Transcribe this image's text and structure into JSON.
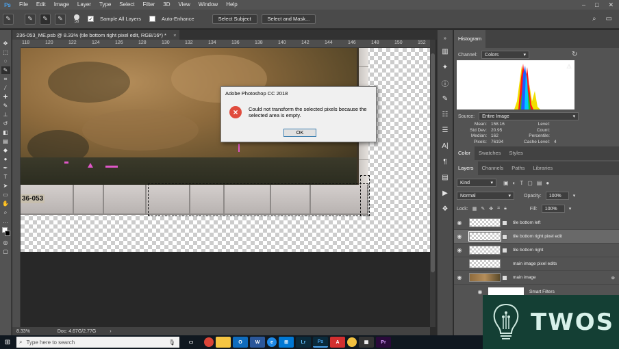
{
  "app": {
    "logo": "Ps"
  },
  "menu": [
    "File",
    "Edit",
    "Image",
    "Layer",
    "Type",
    "Select",
    "Filter",
    "3D",
    "View",
    "Window",
    "Help"
  ],
  "window_controls": {
    "minimize": "–",
    "maximize": "□",
    "close": "✕"
  },
  "options": {
    "brush_size": "58",
    "sample_all_layers": "Sample All Layers",
    "auto_enhance": "Auto-Enhance",
    "select_subject": "Select Subject",
    "select_and_mask": "Select and Mask..."
  },
  "document": {
    "tab_title": "236-053_ME.psb @ 8.33% (tile bottom right pixel edit, RGB/16*) *",
    "close": "×",
    "ruler_ticks": [
      "118",
      "120",
      "122",
      "124",
      "126",
      "128",
      "130",
      "132",
      "134",
      "136",
      "138",
      "140",
      "142",
      "144",
      "146",
      "148",
      "150",
      "152"
    ],
    "plate_text": "36-053"
  },
  "status": {
    "zoom": "8.33%",
    "doc": "Doc: 4.67G/2.77G"
  },
  "dialog": {
    "title": "Adobe Photoshop CC 2018",
    "message": "Could not transform the selected pixels because the selected area is empty.",
    "ok": "OK"
  },
  "histogram": {
    "tab": "Histogram",
    "channel_label": "Channel:",
    "channel_value": "Colors",
    "source_label": "Source:",
    "source_value": "Entire Image",
    "stats_left": [
      {
        "label": "Mean:",
        "value": "158.16"
      },
      {
        "label": "Std Dev:",
        "value": "20.95"
      },
      {
        "label": "Median:",
        "value": "162"
      },
      {
        "label": "Pixels:",
        "value": "76194"
      }
    ],
    "stats_right": [
      {
        "label": "Level:",
        "value": ""
      },
      {
        "label": "Count:",
        "value": ""
      },
      {
        "label": "Percentile:",
        "value": ""
      },
      {
        "label": "Cache Level:",
        "value": "4"
      }
    ]
  },
  "color_tabs": [
    "Color",
    "Swatches",
    "Styles"
  ],
  "layer_tabs": [
    "Layers",
    "Channels",
    "Paths",
    "Libraries"
  ],
  "layers_panel": {
    "kind": "Kind",
    "blend_mode": "Normal",
    "opacity_label": "Opacity:",
    "opacity_value": "100%",
    "lock_label": "Lock:",
    "fill_label": "Fill:",
    "fill_value": "100%",
    "layers": [
      {
        "name": "tile bottom left",
        "visible": true,
        "active": false
      },
      {
        "name": "tile bottom right pixel edit",
        "visible": true,
        "active": true
      },
      {
        "name": "tile bottom right",
        "visible": true,
        "active": false
      },
      {
        "name": "main image pixel edits",
        "visible": false,
        "active": false
      },
      {
        "name": "main image",
        "visible": true,
        "active": false
      }
    ],
    "smart_filters": "Smart Filters"
  },
  "taskbar": {
    "search_placeholder": "Type here to search",
    "apps": [
      "Chrome",
      "Explorer",
      "Outlook",
      "Word",
      "Edge",
      "Store",
      "Lr",
      "Ps",
      "Acrobat",
      "Chrome2",
      "Calc",
      "Pr"
    ]
  },
  "watermark": {
    "text": "TWOS"
  }
}
